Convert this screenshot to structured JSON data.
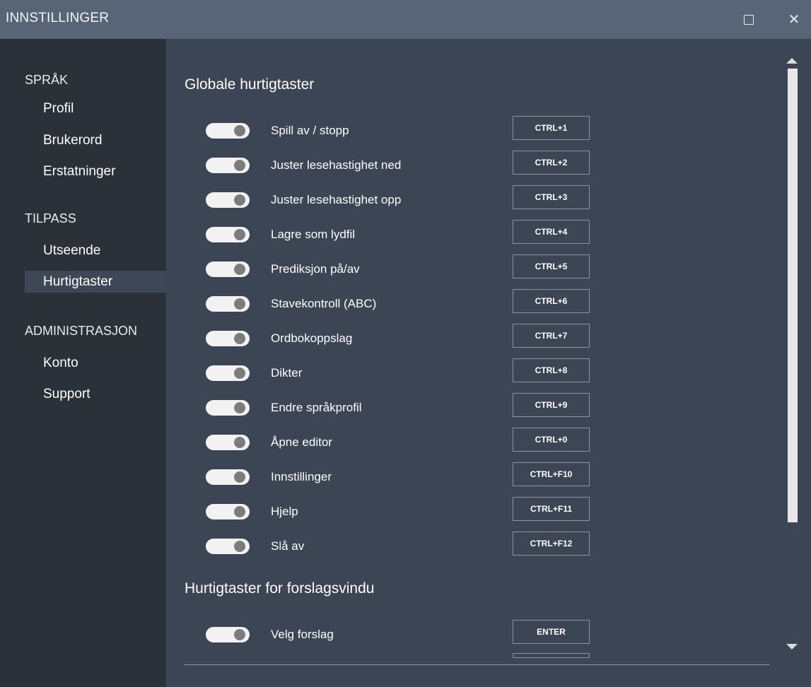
{
  "window": {
    "title": "INNSTILLINGER"
  },
  "sidebar": {
    "sections": [
      {
        "title": "SPRÅK",
        "items": [
          {
            "label": "Profil"
          },
          {
            "label": "Brukerord"
          },
          {
            "label": "Erstatninger"
          }
        ]
      },
      {
        "title": "TILPASS",
        "items": [
          {
            "label": "Utseende"
          },
          {
            "label": "Hurtigtaster",
            "active": true
          }
        ]
      },
      {
        "title": "ADMINISTRASJON",
        "items": [
          {
            "label": "Konto"
          },
          {
            "label": "Support"
          }
        ]
      }
    ]
  },
  "main": {
    "global": {
      "heading": "Globale hurtigtaster",
      "shortcuts": [
        {
          "label": "Spill av / stopp",
          "key": "CTRL+1",
          "enabled": true
        },
        {
          "label": "Juster lesehastighet ned",
          "key": "CTRL+2",
          "enabled": true
        },
        {
          "label": "Juster lesehastighet opp",
          "key": "CTRL+3",
          "enabled": true
        },
        {
          "label": "Lagre som lydfil",
          "key": "CTRL+4",
          "enabled": true
        },
        {
          "label": "Prediksjon på/av",
          "key": "CTRL+5",
          "enabled": true
        },
        {
          "label": "Stavekontroll (ABC)",
          "key": "CTRL+6",
          "enabled": true
        },
        {
          "label": "Ordbokoppslag",
          "key": "CTRL+7",
          "enabled": true
        },
        {
          "label": "Dikter",
          "key": "CTRL+8",
          "enabled": true
        },
        {
          "label": "Endre språkprofil",
          "key": "CTRL+9",
          "enabled": true
        },
        {
          "label": "Åpne editor",
          "key": "CTRL+0",
          "enabled": true
        },
        {
          "label": "Innstillinger",
          "key": "CTRL+F10",
          "enabled": true
        },
        {
          "label": "Hjelp",
          "key": "CTRL+F11",
          "enabled": true
        },
        {
          "label": "Slå av",
          "key": "CTRL+F12",
          "enabled": true
        }
      ]
    },
    "suggestions": {
      "heading": "Hurtigtaster for forslagsvindu",
      "shortcuts": [
        {
          "label": "Velg forslag",
          "key": "ENTER",
          "enabled": true
        }
      ]
    }
  },
  "colors": {
    "titlebar": "#576576",
    "sidebar": "#2b3139",
    "content": "#3b4554",
    "toggle_track": "#f2f2f2",
    "toggle_knob": "#7c7c7c"
  }
}
